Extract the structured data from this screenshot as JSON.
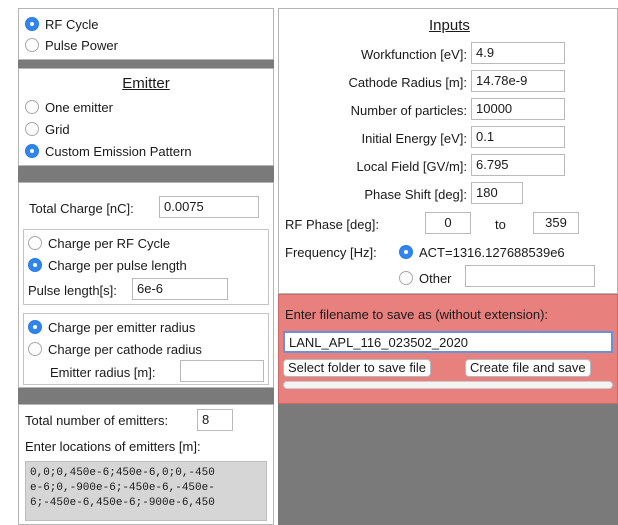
{
  "cycle_mode": {
    "options": [
      "RF Cycle",
      "Pulse Power"
    ],
    "selected": "RF Cycle"
  },
  "emitter": {
    "title": "Emitter",
    "options": [
      "One emitter",
      "Grid",
      "Custom Emission Pattern"
    ],
    "selected": "Custom Emission Pattern"
  },
  "charge": {
    "total_label": "Total Charge [nC]:",
    "total_value": "0.0075",
    "per_options": [
      "Charge per RF Cycle",
      "Charge per pulse length"
    ],
    "per_selected": "Charge per pulse length",
    "pulse_label": "Pulse length[s]:",
    "pulse_value": "6e-6",
    "radius_options": [
      "Charge per emitter radius",
      "Charge per cathode radius"
    ],
    "radius_selected": "Charge per emitter radius",
    "emitter_radius_label": "Emitter radius [m]:",
    "emitter_radius_value": ""
  },
  "emitters": {
    "count_label": "Total number of emitters:",
    "count_value": "8",
    "locations_label": "Enter locations of emitters [m]:",
    "locations_lines": [
      "0,0;0,450e-6;450e-6,0;0,-450",
      "e-6;0,-900e-6;-450e-6,-450e-",
      "6;-450e-6,450e-6;-900e-6,450"
    ]
  },
  "inputs": {
    "title": "Inputs",
    "rows": [
      {
        "label": "Workfunction [eV]:",
        "value": "4.9"
      },
      {
        "label": "Cathode Radius [m]:",
        "value": "14.78e-9"
      },
      {
        "label": "Number of particles:",
        "value": "10000"
      },
      {
        "label": "Initial Energy [eV]:",
        "value": "0.1"
      },
      {
        "label": "Local Field [GV/m]:",
        "value": "6.795"
      },
      {
        "label": "Phase Shift [deg]:",
        "value": "180"
      }
    ],
    "rf_phase_label": "RF Phase [deg]:",
    "rf_phase_from": "0",
    "rf_phase_to_label": "to",
    "rf_phase_to": "359",
    "frequency_label": "Frequency [Hz]:",
    "frequency_options": [
      "ACT=1316.127688539e6",
      "Other"
    ],
    "frequency_selected": "ACT=1316.127688539e6",
    "other_value": ""
  },
  "save": {
    "prompt": "Enter filename to save as (without extension):",
    "filename": "LANL_APL_116_023502_2020",
    "select_folder_label": "Select folder to save file",
    "create_file_label": "Create file and save"
  },
  "colors": {
    "accent": "#2f86f0",
    "save_panel": "#e8807e",
    "gray_bg": "#7a7a7a",
    "locations_bg": "#d6d6d6"
  }
}
